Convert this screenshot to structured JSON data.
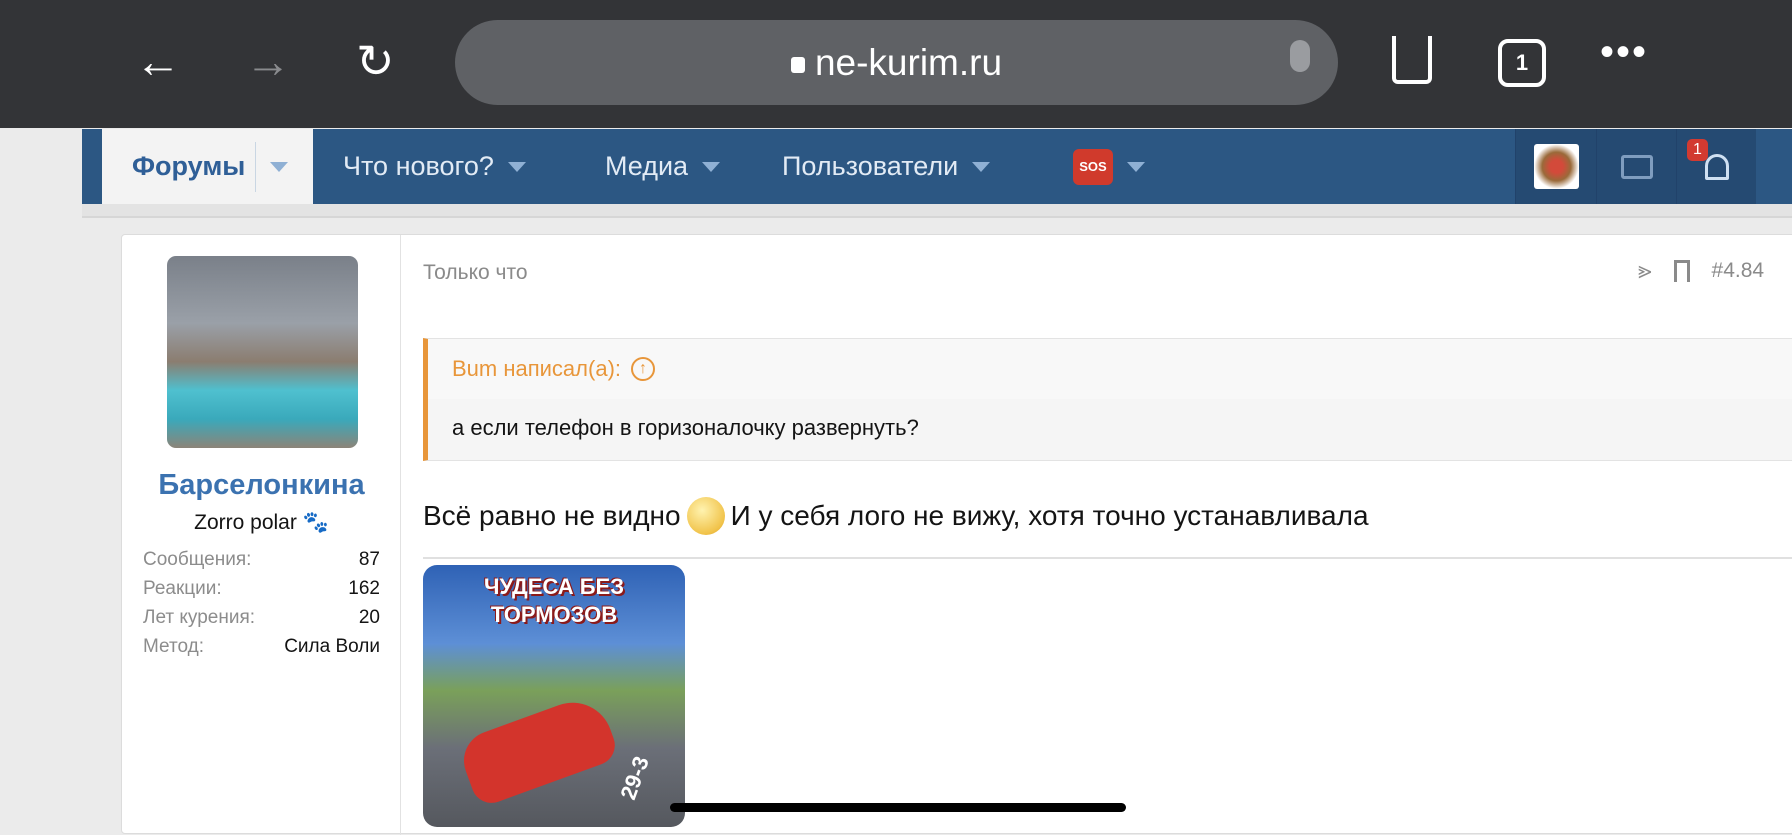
{
  "browser": {
    "url": "ne-kurim.ru",
    "tab_count": "1"
  },
  "nav": {
    "items": [
      {
        "label": "Форумы"
      },
      {
        "label": "Что нового?"
      },
      {
        "label": "Медиа"
      },
      {
        "label": "Пользователи"
      },
      {
        "label": "SOS"
      }
    ],
    "notification_count": "1"
  },
  "user": {
    "name": "Барселонкина",
    "title": "Zorro polar",
    "stats": [
      {
        "label": "Сообщения:",
        "value": "87"
      },
      {
        "label": "Реакции:",
        "value": "162"
      },
      {
        "label": "Лет курения:",
        "value": "20"
      },
      {
        "label": "Метод:",
        "value": "Сила Воли"
      }
    ]
  },
  "post": {
    "time": "Только что",
    "number": "#4.84",
    "quote": {
      "author": "Bum написал(а):",
      "text": "а если телефон в горизоналочку развернуть?"
    },
    "text_before": "Всё равно не видно",
    "text_after": "И у себя лого не вижу, хотя точно устанавливала",
    "image_caption": "ЧУДЕСА БЕЗ ТОРМОЗОВ",
    "image_sub": "29-3"
  }
}
